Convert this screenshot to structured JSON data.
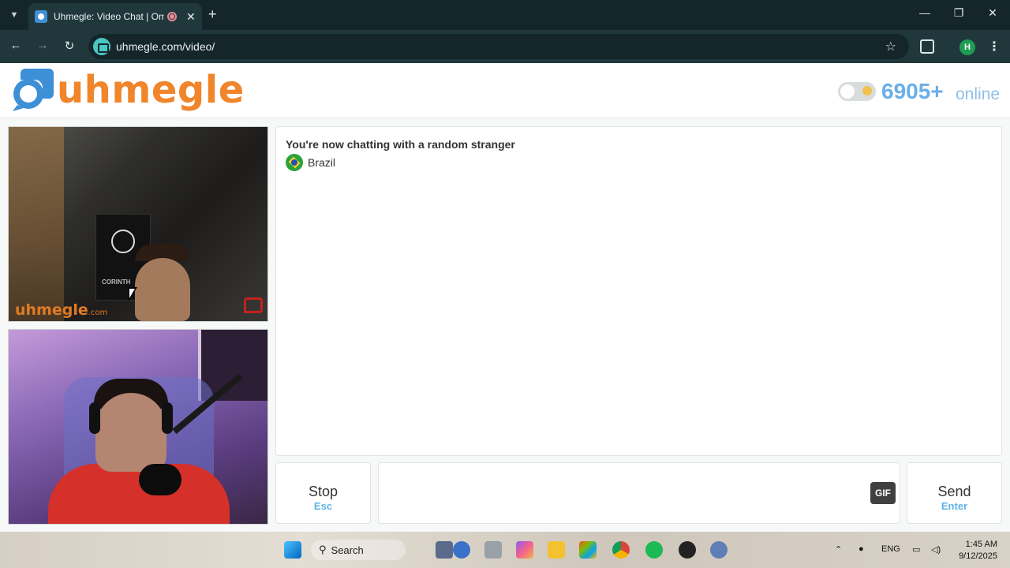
{
  "browser": {
    "tab_title": "Uhmegle: Video Chat | Ome",
    "url": "uhmegle.com/video/",
    "profile_initial": "H"
  },
  "header": {
    "logo_text": "uhmegle",
    "online_count": "6905+",
    "online_label": "online"
  },
  "videos": {
    "watermark_main": "uhmegle",
    "watermark_suffix": ".com",
    "flag_text": "CORINTH"
  },
  "chat": {
    "status": "You're now chatting with a random stranger",
    "country": "Brazil"
  },
  "controls": {
    "stop_label": "Stop",
    "stop_key": "Esc",
    "gif_label": "GIF",
    "send_label": "Send",
    "send_key": "Enter"
  },
  "taskbar": {
    "search_label": "Search",
    "language": "ENG",
    "time": "1:45 AM",
    "date": "9/12/2025"
  },
  "colors": {
    "accent_orange": "#f0852b",
    "accent_blue": "#5fb2e6",
    "chrome_dark": "#15262a"
  }
}
